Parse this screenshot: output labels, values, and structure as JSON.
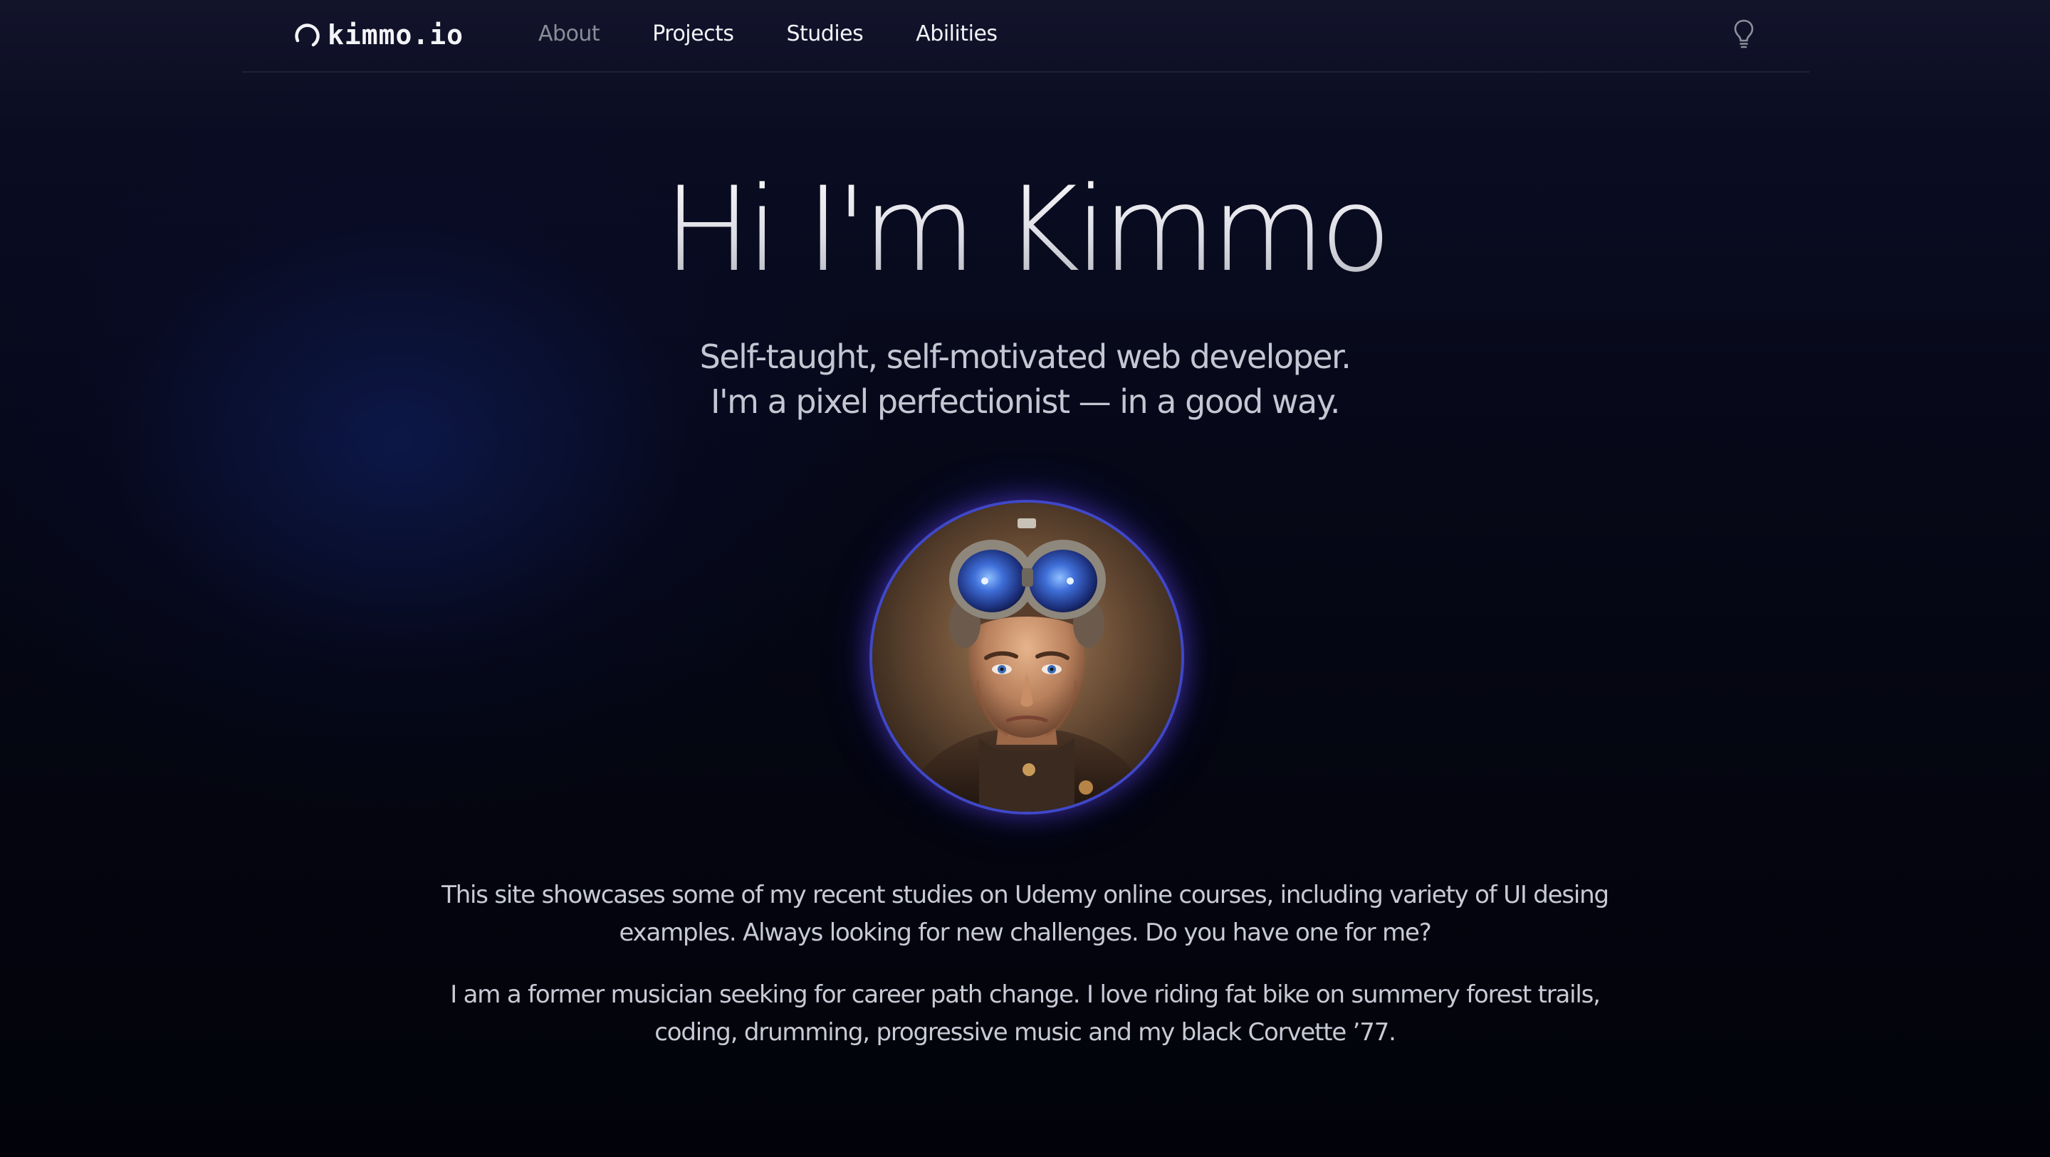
{
  "header": {
    "logo_text": "kimmo.io",
    "nav": [
      {
        "label": "About",
        "active": true
      },
      {
        "label": "Projects",
        "active": false
      },
      {
        "label": "Studies",
        "active": false
      },
      {
        "label": "Abilities",
        "active": false
      }
    ],
    "theme_toggle_icon": "lightbulb-icon"
  },
  "hero": {
    "title": "Hi I'm Kimmo",
    "subtitle_line1": "Self-taught, self-motivated web developer.",
    "subtitle_line2": "I'm a pixel perfectionist — in a good way."
  },
  "avatar": {
    "alt": "Portrait of a man wearing aviator goggles",
    "ring_color": "#4048c8"
  },
  "about": {
    "paragraph1": "This site showcases some of my recent studies on Udemy online courses, including variety of UI desing examples. Always looking for new challenges. Do you have one for me?",
    "paragraph2": "I am a former musician seeking for career path change. I love riding fat bike on summery forest trails, coding, drumming, progressive music and my black Corvette ’77."
  },
  "colors": {
    "background": "#03040d",
    "nav_active": "#8a8c98",
    "text": "#c8cad6",
    "accent": "#4048c8"
  }
}
